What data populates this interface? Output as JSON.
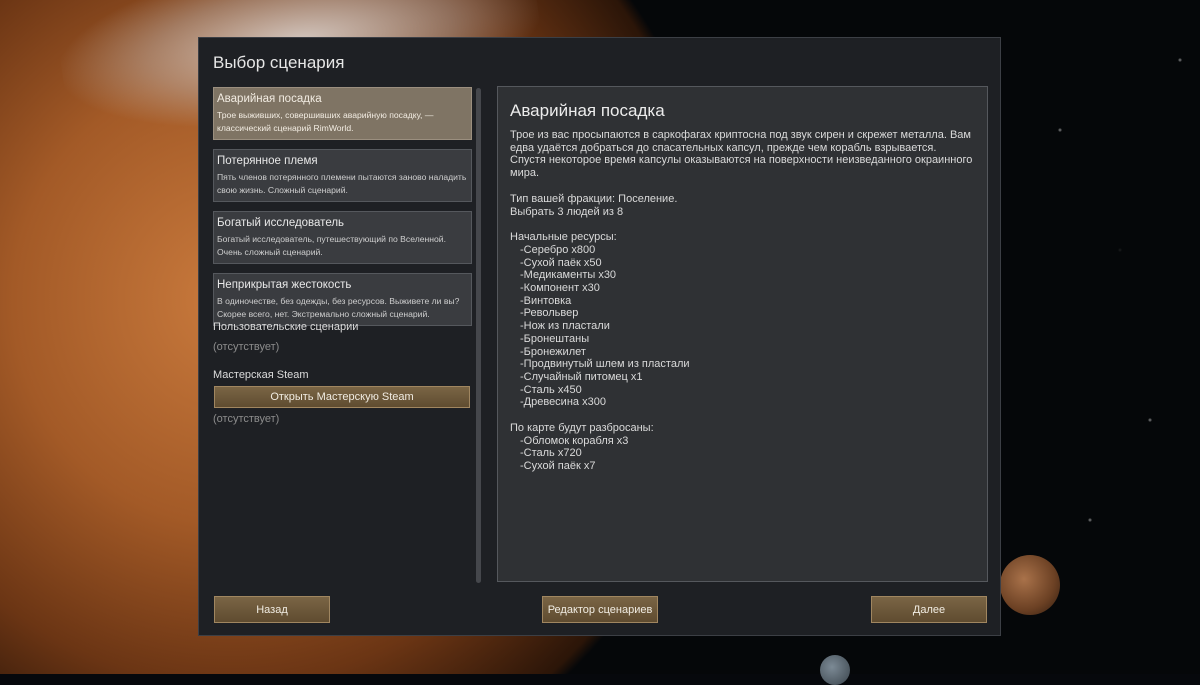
{
  "dialog": {
    "title": "Выбор сценария"
  },
  "scenarios": [
    {
      "name": "Аварийная посадка",
      "desc": "Трое выживших, совершивших аварийную посадку, — классический сценарий RimWorld.",
      "selected": true
    },
    {
      "name": "Потерянное племя",
      "desc": "Пять членов потерянного племени пытаются заново наладить свою жизнь. Сложный сценарий.",
      "selected": false
    },
    {
      "name": "Богатый исследователь",
      "desc": "Богатый исследователь, путешествующий по Вселенной. Очень сложный сценарий.",
      "selected": false
    },
    {
      "name": "Неприкрытая жестокость",
      "desc": "В одиночестве, без одежды, без ресурсов. Выживете ли вы? Скорее всего, нет. Экстремально сложный сценарий.",
      "selected": false
    }
  ],
  "custom": {
    "label": "Пользовательские сценарии",
    "absent": "(отсутствует)"
  },
  "workshop": {
    "label": "Мастерская Steam",
    "button": "Открыть Мастерскую Steam",
    "absent": "(отсутствует)"
  },
  "detail": {
    "heading": "Аварийная посадка",
    "intro": "Трое из вас просыпаются в саркофагах криптосна под звук сирен и скрежет металла. Вам едва удаётся добраться до спасательных капсул, прежде чем корабль взрывается. Спустя некоторое время капсулы оказываются на поверхности неизведанного окраинного мира.",
    "faction_type": "Тип вашей фракции: Поселение.",
    "choose": "Выбрать 3 людей из 8",
    "resources_title": "Начальные ресурсы:",
    "resources": [
      "-Серебро x800",
      "-Сухой паёк x50",
      "-Медикаменты x30",
      "-Компонент x30",
      "-Винтовка",
      "-Револьвер",
      "-Нож из пластали",
      "-Бронештаны",
      "-Бронежилет",
      "-Продвинутый шлем из пластали",
      "-Случайный питомец x1",
      "-Сталь x450",
      "-Древесина x300"
    ],
    "scattered_title": "По карте будут разбросаны:",
    "scattered": [
      "-Обломок корабля x3",
      "-Сталь x720",
      "-Сухой паёк x7"
    ]
  },
  "buttons": {
    "back": "Назад",
    "editor": "Редактор сценариев",
    "next": "Далее"
  },
  "colors": {
    "button": "#6e5a3c",
    "selected_item": "#7f7464",
    "panel": "#1e2024"
  }
}
